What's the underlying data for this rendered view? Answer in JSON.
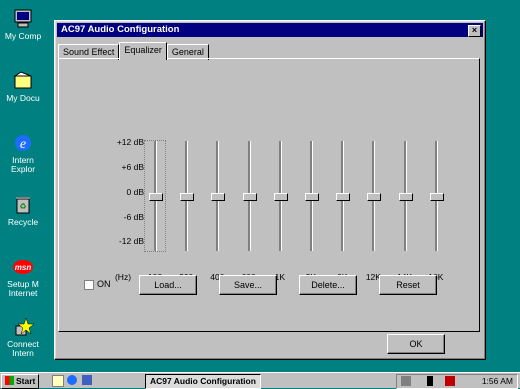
{
  "window": {
    "title": "AC97 Audio Configuration",
    "close": "×",
    "tabs": [
      {
        "label": "Sound Effect"
      },
      {
        "label": "Equalizer"
      },
      {
        "label": "General"
      }
    ]
  },
  "desktop": {
    "icons": [
      {
        "label": "My Comp",
        "icon": "my-computer-icon"
      },
      {
        "label": "My Docu",
        "icon": "my-documents-icon"
      },
      {
        "label": "Intern\nExplor",
        "icon": "internet-explorer-icon"
      },
      {
        "label": "Recycle",
        "icon": "recycle-bin-icon"
      },
      {
        "label": "Setup M\nInternet",
        "icon": "msn-icon"
      },
      {
        "label": "Connect\nIntern",
        "icon": "connect-icon"
      }
    ]
  },
  "equalizer": {
    "db_labels": [
      "+12 dB",
      "+6 dB",
      "0 dB",
      "-6 dB",
      "-12 dB"
    ],
    "hz_unit": "(Hz)",
    "bands": [
      "100",
      "200",
      "400",
      "600",
      "1K",
      "3K",
      "6K",
      "12K",
      "14K",
      "16K"
    ],
    "levels_db": [
      0,
      0,
      0,
      0,
      0,
      0,
      0,
      0,
      0,
      0
    ]
  },
  "controls": {
    "on_label": "ON",
    "load": "Load...",
    "save": "Save...",
    "delete": "Delete...",
    "reset": "Reset",
    "ok": "OK"
  },
  "taskbar": {
    "start": "Start",
    "task": "AC97 Audio Configuration",
    "clock": "1:56 AM"
  }
}
